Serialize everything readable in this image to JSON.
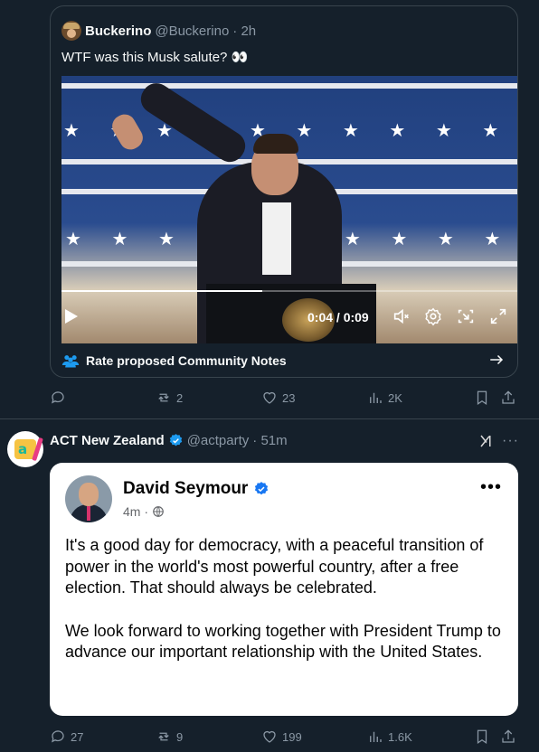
{
  "quoted_tweet": {
    "author_name": "Buckerino",
    "author_handle": "@Buckerino",
    "time": "· 2h",
    "text": "WTF was this Musk salute? 👀",
    "video": {
      "current_time": "0:04",
      "duration": "0:09",
      "time_display": "0:04 / 0:09",
      "progress_fraction": 0.44
    },
    "community_notes_label": "Rate proposed Community Notes"
  },
  "tweet1_actions": {
    "replies": "",
    "retweets": "2",
    "likes": "23",
    "views": "2K"
  },
  "tweet2": {
    "author_name": "ACT New Zealand",
    "author_handle": "@actparty",
    "time": "· 51m",
    "embedded_post": {
      "author_name": "David Seymour",
      "time": "4m ·",
      "paragraphs": [
        "It's a good day for democracy, with a peaceful transition of power in the world's most powerful country, after a free election. That should always be celebrated.",
        "We look forward to working together with President Trump to advance our important relationship with the United States."
      ]
    },
    "actions": {
      "replies": "27",
      "retweets": "9",
      "likes": "199",
      "views": "1.6K"
    }
  },
  "colors": {
    "background": "#15202b",
    "border": "#38444d",
    "muted_text": "#8b98a5",
    "accent_blue": "#1d9bf0"
  }
}
